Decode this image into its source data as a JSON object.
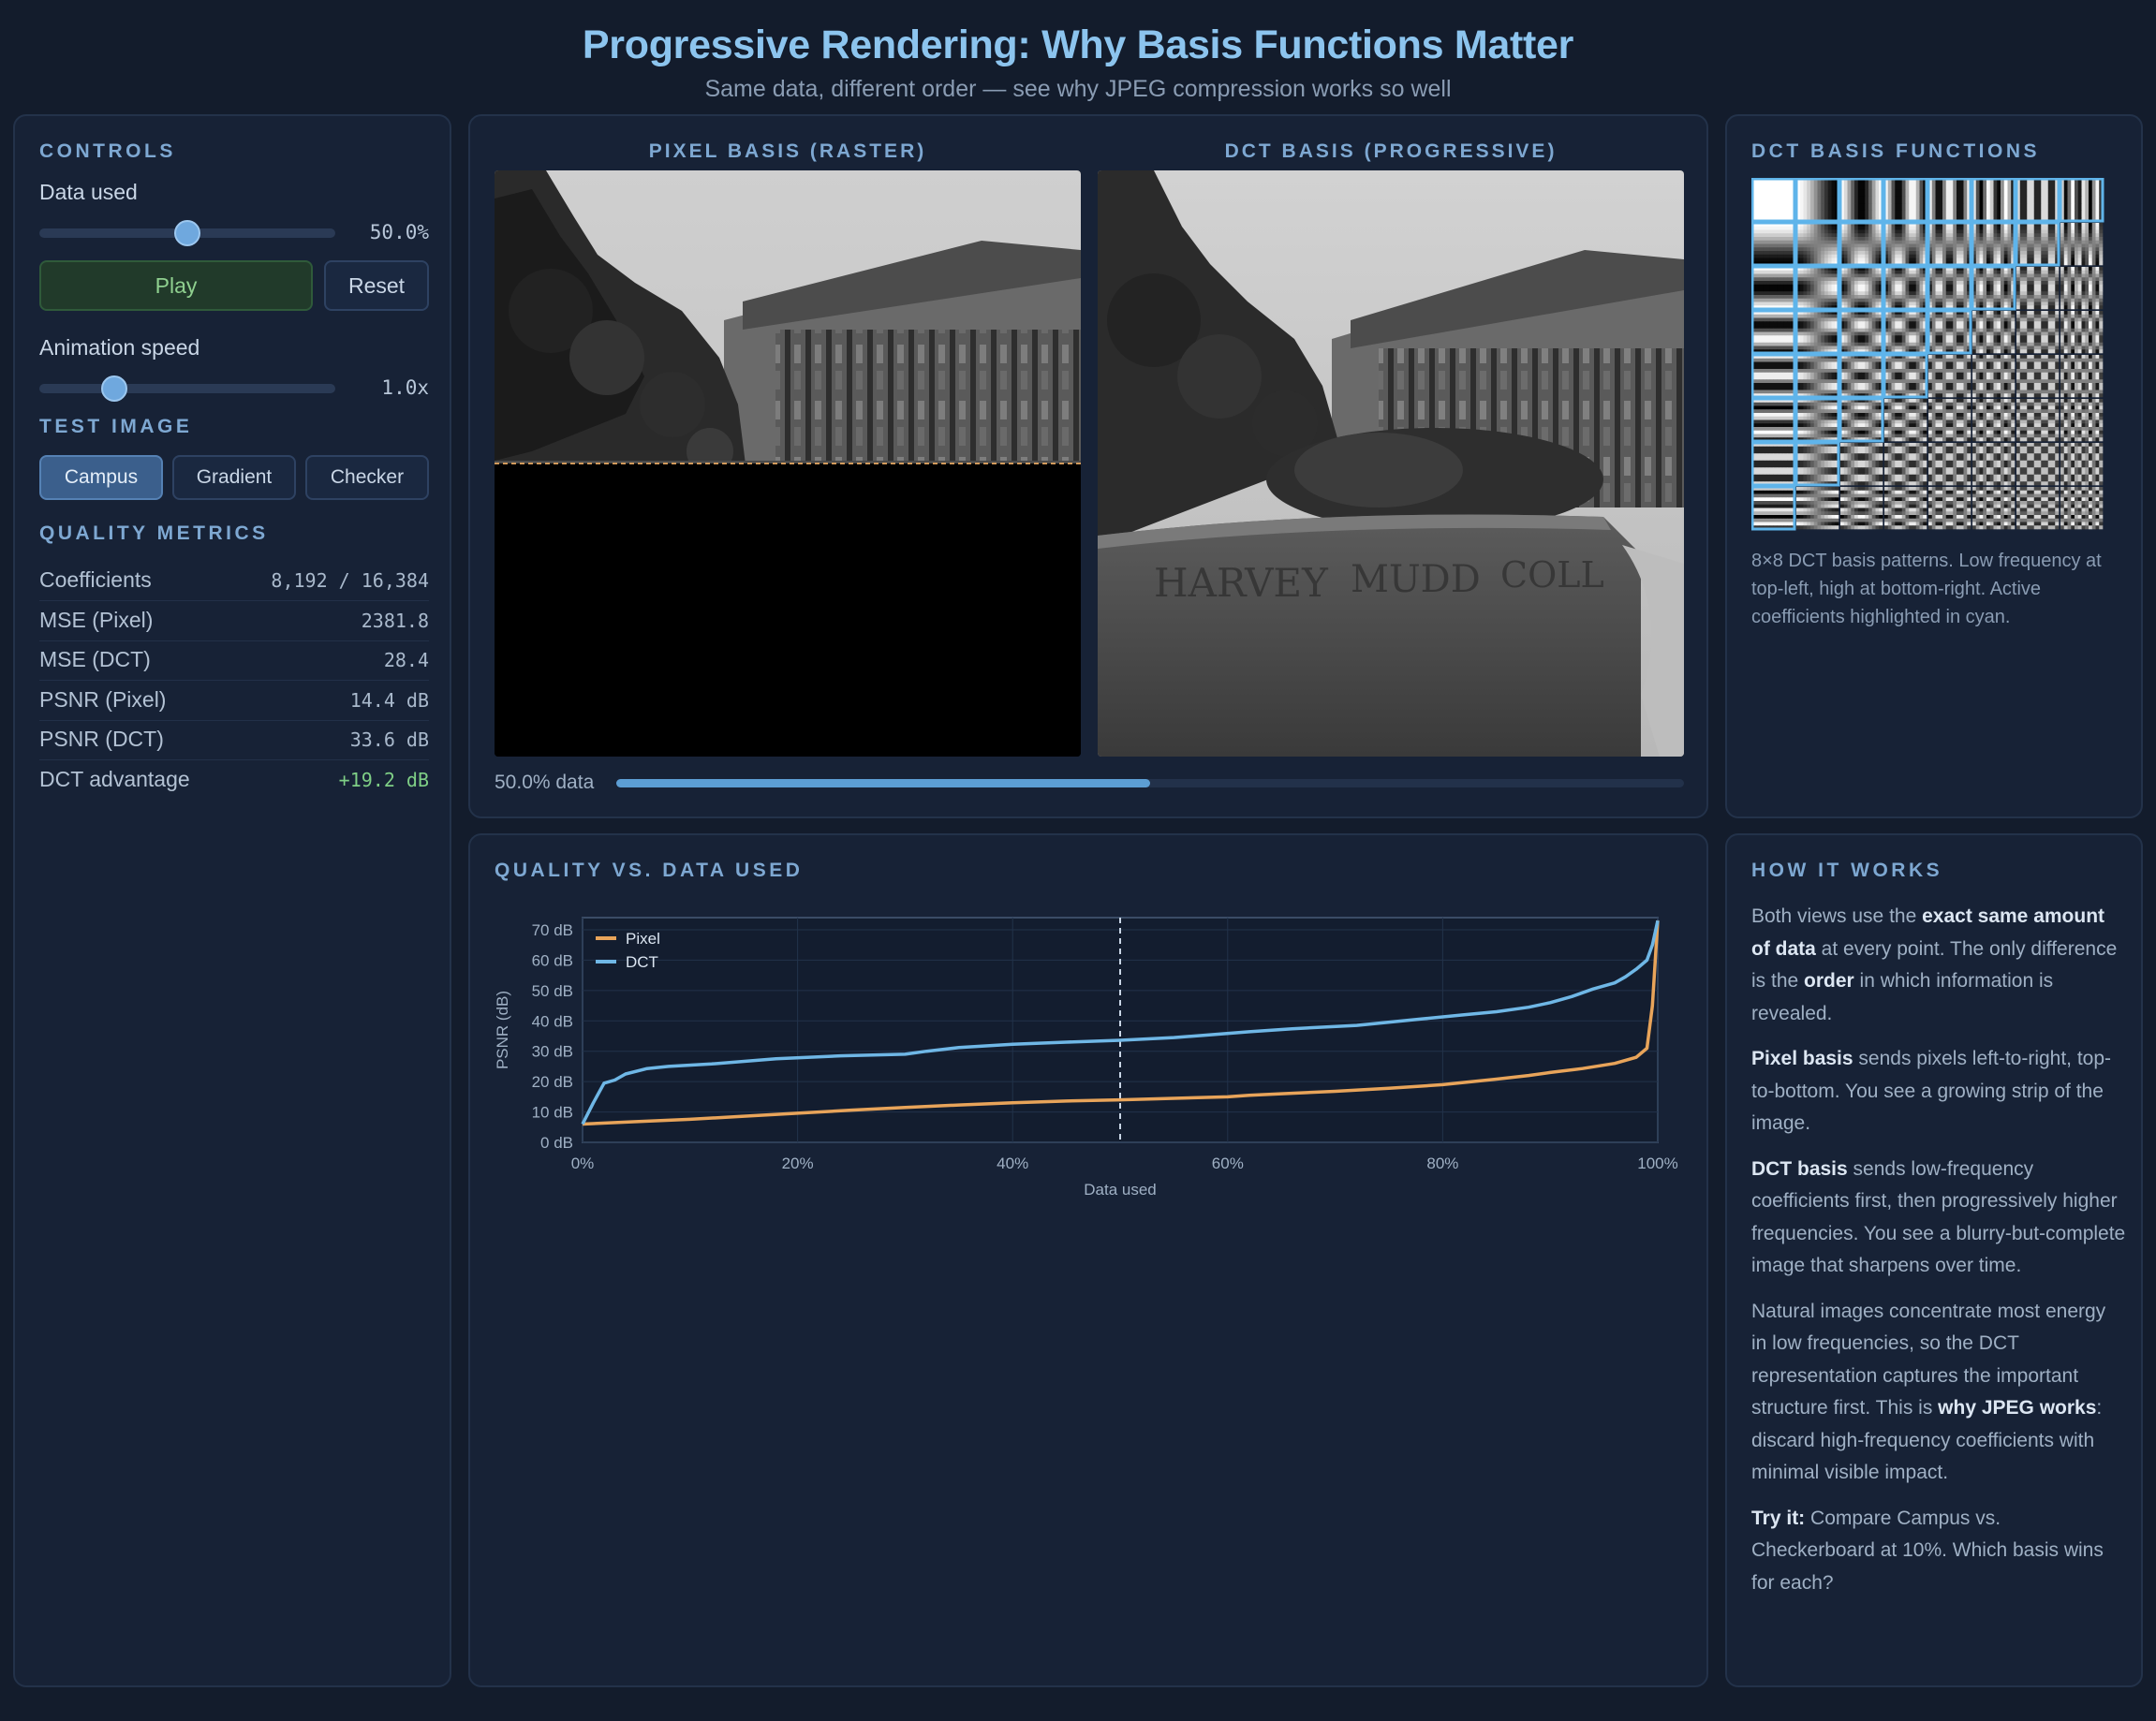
{
  "header": {
    "title": "Progressive Rendering: Why Basis Functions Matter",
    "subtitle": "Same data, different order — see why JPEG compression works so well"
  },
  "controls": {
    "section_title": "CONTROLS",
    "data_used_label": "Data used",
    "data_used_value": "50.0%",
    "data_used_fraction": 0.5,
    "play_label": "Play",
    "reset_label": "Reset",
    "speed_label": "Animation speed",
    "speed_value": "1.0x",
    "speed_fraction": 0.23
  },
  "test_image": {
    "section_title": "TEST IMAGE",
    "options": [
      "Campus",
      "Gradient",
      "Checker"
    ],
    "selected": "Campus"
  },
  "metrics": {
    "section_title": "QUALITY METRICS",
    "rows": [
      {
        "label": "Coefficients",
        "value": "8,192 / 16,384"
      },
      {
        "label": "MSE (Pixel)",
        "value": "2381.8"
      },
      {
        "label": "MSE (DCT)",
        "value": "28.4"
      },
      {
        "label": "PSNR (Pixel)",
        "value": "14.4 dB"
      },
      {
        "label": "PSNR (DCT)",
        "value": "33.6 dB"
      },
      {
        "label": "DCT advantage",
        "value": "+19.2 dB"
      }
    ],
    "advantage_color": "#7fcf86"
  },
  "views": {
    "pixel_title": "PIXEL BASIS (RASTER)",
    "dct_title": "DCT BASIS (PROGRESSIVE)",
    "progress_label": "50.0% data",
    "progress_fraction": 0.5,
    "pixel_reveal_fraction": 0.5
  },
  "basis": {
    "section_title": "DCT BASIS FUNCTIONS",
    "caption": "8×8 DCT basis patterns. Low frequency at top-left, high at bottom-right. Active coefficients highlighted in cyan.",
    "highlight_color": "#5fb4ea"
  },
  "chart_section_title": "QUALITY VS. DATA USED",
  "chart_data": {
    "type": "line",
    "xlabel": "Data used",
    "ylabel": "PSNR (dB)",
    "xlim": [
      0,
      100
    ],
    "ylim": [
      0,
      74
    ],
    "x_ticks": [
      "0%",
      "20%",
      "40%",
      "60%",
      "80%",
      "100%"
    ],
    "y_ticks": [
      "0 dB",
      "10 dB",
      "20 dB",
      "30 dB",
      "40 dB",
      "50 dB",
      "60 dB",
      "70 dB"
    ],
    "grid": true,
    "legend_position": "top-left",
    "marker_x": 50,
    "series": [
      {
        "name": "Pixel",
        "color": "#e8a45a",
        "x": [
          0,
          5,
          10,
          15,
          20,
          25,
          30,
          35,
          40,
          45,
          50,
          55,
          60,
          62,
          65,
          70,
          75,
          80,
          85,
          88,
          90,
          93,
          96,
          98,
          99,
          99.5,
          100
        ],
        "y": [
          6,
          6.8,
          7.6,
          8.6,
          9.6,
          10.6,
          11.5,
          12.3,
          13,
          13.6,
          14,
          14.5,
          15,
          15.5,
          16,
          16.8,
          17.8,
          19,
          20.8,
          22,
          23,
          24.3,
          26,
          28,
          31,
          45,
          73
        ]
      },
      {
        "name": "DCT",
        "color": "#6fb7e6",
        "x": [
          0,
          1,
          2,
          3,
          4,
          6,
          8,
          12,
          18,
          24,
          30,
          32,
          35,
          40,
          45,
          50,
          55,
          58,
          62,
          66,
          72,
          78,
          82,
          85,
          88,
          90,
          92,
          94,
          96,
          97,
          98,
          99,
          99.5,
          100
        ],
        "y": [
          6,
          13,
          19.5,
          20.5,
          22.5,
          24.3,
          25,
          25.8,
          27.5,
          28.5,
          29,
          30,
          31.2,
          32.3,
          33,
          33.6,
          34.5,
          35.3,
          36.4,
          37.4,
          38.5,
          40.6,
          42,
          43,
          44.5,
          46,
          48,
          50.5,
          52.5,
          54.5,
          57,
          60,
          65,
          73
        ]
      }
    ]
  },
  "how": {
    "section_title": "HOW IT WORKS",
    "p1_a": "Both views use the ",
    "p1_b": "exact same amount of data",
    "p1_c": " at every point. The only difference is the ",
    "p1_d": "order",
    "p1_e": " in which information is revealed.",
    "p2_a": "Pixel basis",
    "p2_b": " sends pixels left-to-right, top-to-bottom. You see a growing strip of the image.",
    "p3_a": "DCT basis",
    "p3_b": " sends low-frequency coefficients first, then progressively higher frequencies. You see a blurry-but-complete image that sharpens over time.",
    "p4_a": "Natural images concentrate most energy in low frequencies, so the DCT representation captures the important structure first. This is ",
    "p4_b": "why JPEG works",
    "p4_c": ": discard high-frequency coefficients with minimal visible impact.",
    "p5_a": "Try it:",
    "p5_b": " Compare Campus vs. Checkerboard at 10%. Which basis wins for each?"
  }
}
